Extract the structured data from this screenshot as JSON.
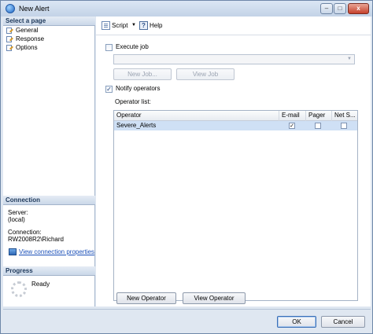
{
  "window": {
    "title": "New Alert",
    "controls": {
      "minimize": "–",
      "maximize": "□",
      "close": "x"
    }
  },
  "left_pane": {
    "select_page": {
      "header": "Select a page",
      "items": [
        {
          "label": "General",
          "icon": "page-icon"
        },
        {
          "label": "Response",
          "icon": "page-icon"
        },
        {
          "label": "Options",
          "icon": "page-icon"
        }
      ]
    },
    "connection": {
      "header": "Connection",
      "server_label": "Server:",
      "server_value": "(local)",
      "connection_label": "Connection:",
      "connection_value": "RW2008R2\\Richard",
      "view_properties_link": "View connection properties"
    },
    "progress": {
      "header": "Progress",
      "status": "Ready"
    }
  },
  "toolbar": {
    "script_label": "Script",
    "script_dropdown_arrow": "▼",
    "help_label": "Help",
    "help_icon_glyph": "?"
  },
  "response": {
    "execute_job": {
      "label": "Execute job",
      "checked": false
    },
    "job_combo": {
      "value": "",
      "arrow": "▼"
    },
    "new_job_button": "New Job...",
    "view_job_button": "View Job",
    "notify_operators": {
      "label": "Notify operators",
      "checked": true,
      "check_glyph": "✓"
    },
    "operator_list_label": "Operator list:",
    "grid": {
      "columns": [
        "Operator",
        "E-mail",
        "Pager",
        "Net S..."
      ],
      "rows": [
        {
          "operator": "Severe_Alerts",
          "email": true,
          "pager": false,
          "net_send": false,
          "selected": true
        }
      ],
      "check_glyph": "✓"
    },
    "new_operator_button": "New Operator",
    "view_operator_button": "View Operator"
  },
  "footer": {
    "ok_button": "OK",
    "cancel_button": "Cancel"
  },
  "colors": {
    "window_bg": "#dfe7f1",
    "selected_row": "#cfe0f5",
    "link": "#1a4fb8",
    "section_header_text": "#1e395b"
  }
}
